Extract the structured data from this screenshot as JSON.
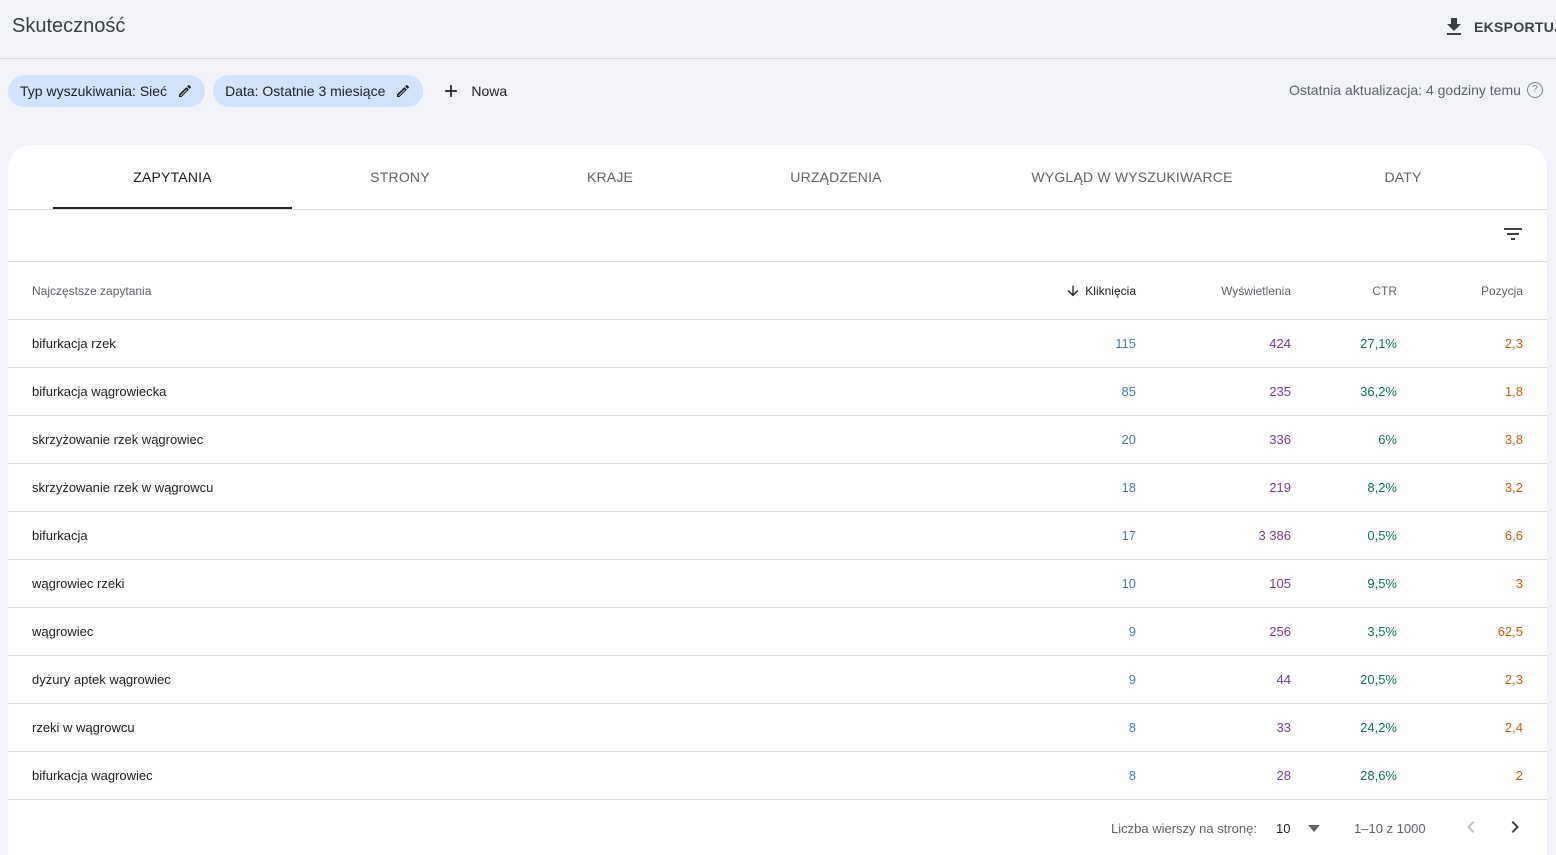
{
  "header": {
    "title": "Skuteczność",
    "export_label": "EKSPORTUJ"
  },
  "filters": {
    "chips": [
      {
        "label": "Typ wyszukiwania: Sieć"
      },
      {
        "label": "Data: Ostatnie 3 miesiące"
      }
    ],
    "new_label": "Nowa",
    "last_update": "Ostatnia aktualizacja: 4 godziny temu",
    "help_glyph": "?"
  },
  "tabs": [
    {
      "label": "ZAPYTANIA",
      "active": true
    },
    {
      "label": "STRONY",
      "active": false
    },
    {
      "label": "KRAJE",
      "active": false
    },
    {
      "label": "URZĄDZENIA",
      "active": false
    },
    {
      "label": "WYGLĄD W WYSZUKIWARCE",
      "active": false
    },
    {
      "label": "DATY",
      "active": false
    }
  ],
  "table": {
    "columns": {
      "query": "Najczęstsze zapytania",
      "clicks": "Kliknięcia",
      "impressions": "Wyświetlenia",
      "ctr": "CTR",
      "position": "Pozycja"
    },
    "sorted_by": "clicks",
    "colors": {
      "clicks": "#4a76c9",
      "impressions": "#7b3a96",
      "ctr": "#11705f",
      "position": "#d3590b"
    },
    "rows": [
      {
        "query": "bifurkacja rzek",
        "clicks": "115",
        "impressions": "424",
        "ctr": "27,1%",
        "position": "2,3"
      },
      {
        "query": "bifurkacja wągrowiecka",
        "clicks": "85",
        "impressions": "235",
        "ctr": "36,2%",
        "position": "1,8"
      },
      {
        "query": "skrzyżowanie rzek wągrowiec",
        "clicks": "20",
        "impressions": "336",
        "ctr": "6%",
        "position": "3,8"
      },
      {
        "query": "skrzyżowanie rzek w wągrowcu",
        "clicks": "18",
        "impressions": "219",
        "ctr": "8,2%",
        "position": "3,2"
      },
      {
        "query": "bifurkacja",
        "clicks": "17",
        "impressions": "3 386",
        "ctr": "0,5%",
        "position": "6,6"
      },
      {
        "query": "wągrowiec rzeki",
        "clicks": "10",
        "impressions": "105",
        "ctr": "9,5%",
        "position": "3"
      },
      {
        "query": "wągrowiec",
        "clicks": "9",
        "impressions": "256",
        "ctr": "3,5%",
        "position": "62,5"
      },
      {
        "query": "dyżury aptek wągrowiec",
        "clicks": "9",
        "impressions": "44",
        "ctr": "20,5%",
        "position": "2,3"
      },
      {
        "query": "rzeki w wągrowcu",
        "clicks": "8",
        "impressions": "33",
        "ctr": "24,2%",
        "position": "2,4"
      },
      {
        "query": "bifurkacja wagrowiec",
        "clicks": "8",
        "impressions": "28",
        "ctr": "28,6%",
        "position": "2"
      }
    ]
  },
  "pagination": {
    "rows_per_page_label": "Liczba wierszy na stronę:",
    "rows_per_page_value": "10",
    "range": "1–10 z 1000"
  },
  "icons": {
    "export": "download-icon",
    "chip_edit": "pencil-icon",
    "new": "plus-icon",
    "help": "help-circle-icon",
    "filter": "filter-list-icon",
    "sort": "arrow-down-icon",
    "prev": "chevron-left-icon",
    "next": "chevron-right-icon"
  }
}
